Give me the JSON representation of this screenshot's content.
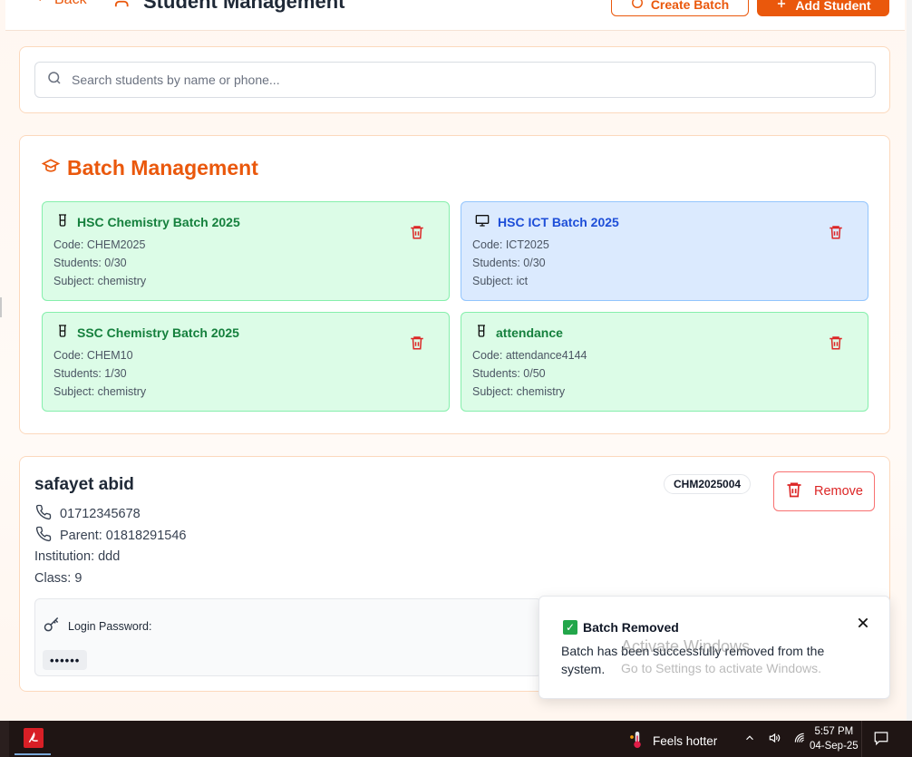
{
  "header": {
    "back_label": "Back",
    "title": "Student Management",
    "create_batch_label": "Create Batch",
    "add_student_label": "Add Student"
  },
  "search": {
    "placeholder": "Search students by name or phone..."
  },
  "batch_section": {
    "title": "Batch Management",
    "batches": [
      {
        "name": "HSC Chemistry Batch 2025",
        "code": "Code: CHEM2025",
        "students": "Students: 0/30",
        "subject": "Subject: chemistry",
        "color": "green",
        "icon": "beaker-icon"
      },
      {
        "name": "HSC ICT Batch 2025",
        "code": "Code: ICT2025",
        "students": "Students: 0/30",
        "subject": "Subject: ict",
        "color": "blue",
        "icon": "monitor-icon"
      },
      {
        "name": "SSC Chemistry Batch 2025",
        "code": "Code: CHEM10",
        "students": "Students: 1/30",
        "subject": "Subject: chemistry",
        "color": "green",
        "icon": "beaker-icon"
      },
      {
        "name": "attendance",
        "code": "Code: attendance4144",
        "students": "Students: 0/50",
        "subject": "Subject: chemistry",
        "color": "green",
        "icon": "beaker-icon"
      }
    ]
  },
  "student": {
    "name": "safayet abid",
    "student_id": "CHM2025004",
    "phone": "01712345678",
    "parent_phone": "Parent: 01818291546",
    "institution": "Institution: ddd",
    "class": "Class: 9",
    "remove_label": "Remove",
    "password_label": "Login Password:",
    "password_value": "••••••"
  },
  "toast": {
    "title": "Batch Removed",
    "message": "Batch has been successfully removed from the system."
  },
  "watermark": {
    "line1": "Activate Windows",
    "line2": "Go to Settings to activate Windows."
  },
  "taskbar": {
    "weather": "Feels hotter",
    "time": "5:57 PM",
    "date": "04-Sep-25"
  },
  "colors": {
    "accent": "#ea580c",
    "green_tile": "#dcfce7",
    "blue_tile": "#dbeafe",
    "danger": "#dc2626"
  }
}
